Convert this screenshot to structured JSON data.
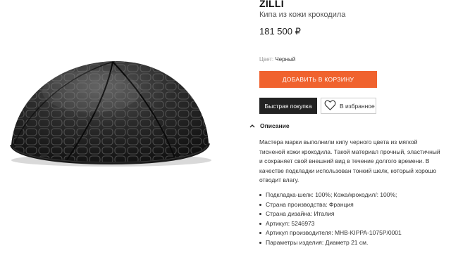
{
  "product": {
    "brand": "ZILLI",
    "name": "Кипа из кожи крокодила",
    "price": "181 500 ₽",
    "color_label": "Цвет:",
    "color_value": "Черный"
  },
  "actions": {
    "add_to_cart": "ДОБАВИТЬ В КОРЗИНУ",
    "quick_buy": "Быстрая покупка",
    "favorites": "В избранное"
  },
  "description": {
    "heading": "Описание",
    "text": "Мастера марки выполнили кипу черного цвета из мягкой тисненой кожи крокодила. Такой  материал прочный, эластичный и сохраняет свой внешний вид в течение долгого времени. В качестве подкладки использован тонкий шелк, который хорошо отводит влагу.",
    "specs": [
      "Подкладка-шелк: 100%; Кожа/крокодил/: 100%;",
      "Страна производства: Франция",
      "Страна дизайна: Италия",
      "Артикул: 5246973",
      "Артикул производителя: MHB-KIPPA-1075P/0001",
      "Параметры изделия: Диаметр 21 см."
    ]
  },
  "icons": {
    "favorites": "heart-icon",
    "description_toggle": "chevron-up-icon"
  },
  "colors": {
    "accent": "#f0622e",
    "dark_button": "#222222"
  }
}
